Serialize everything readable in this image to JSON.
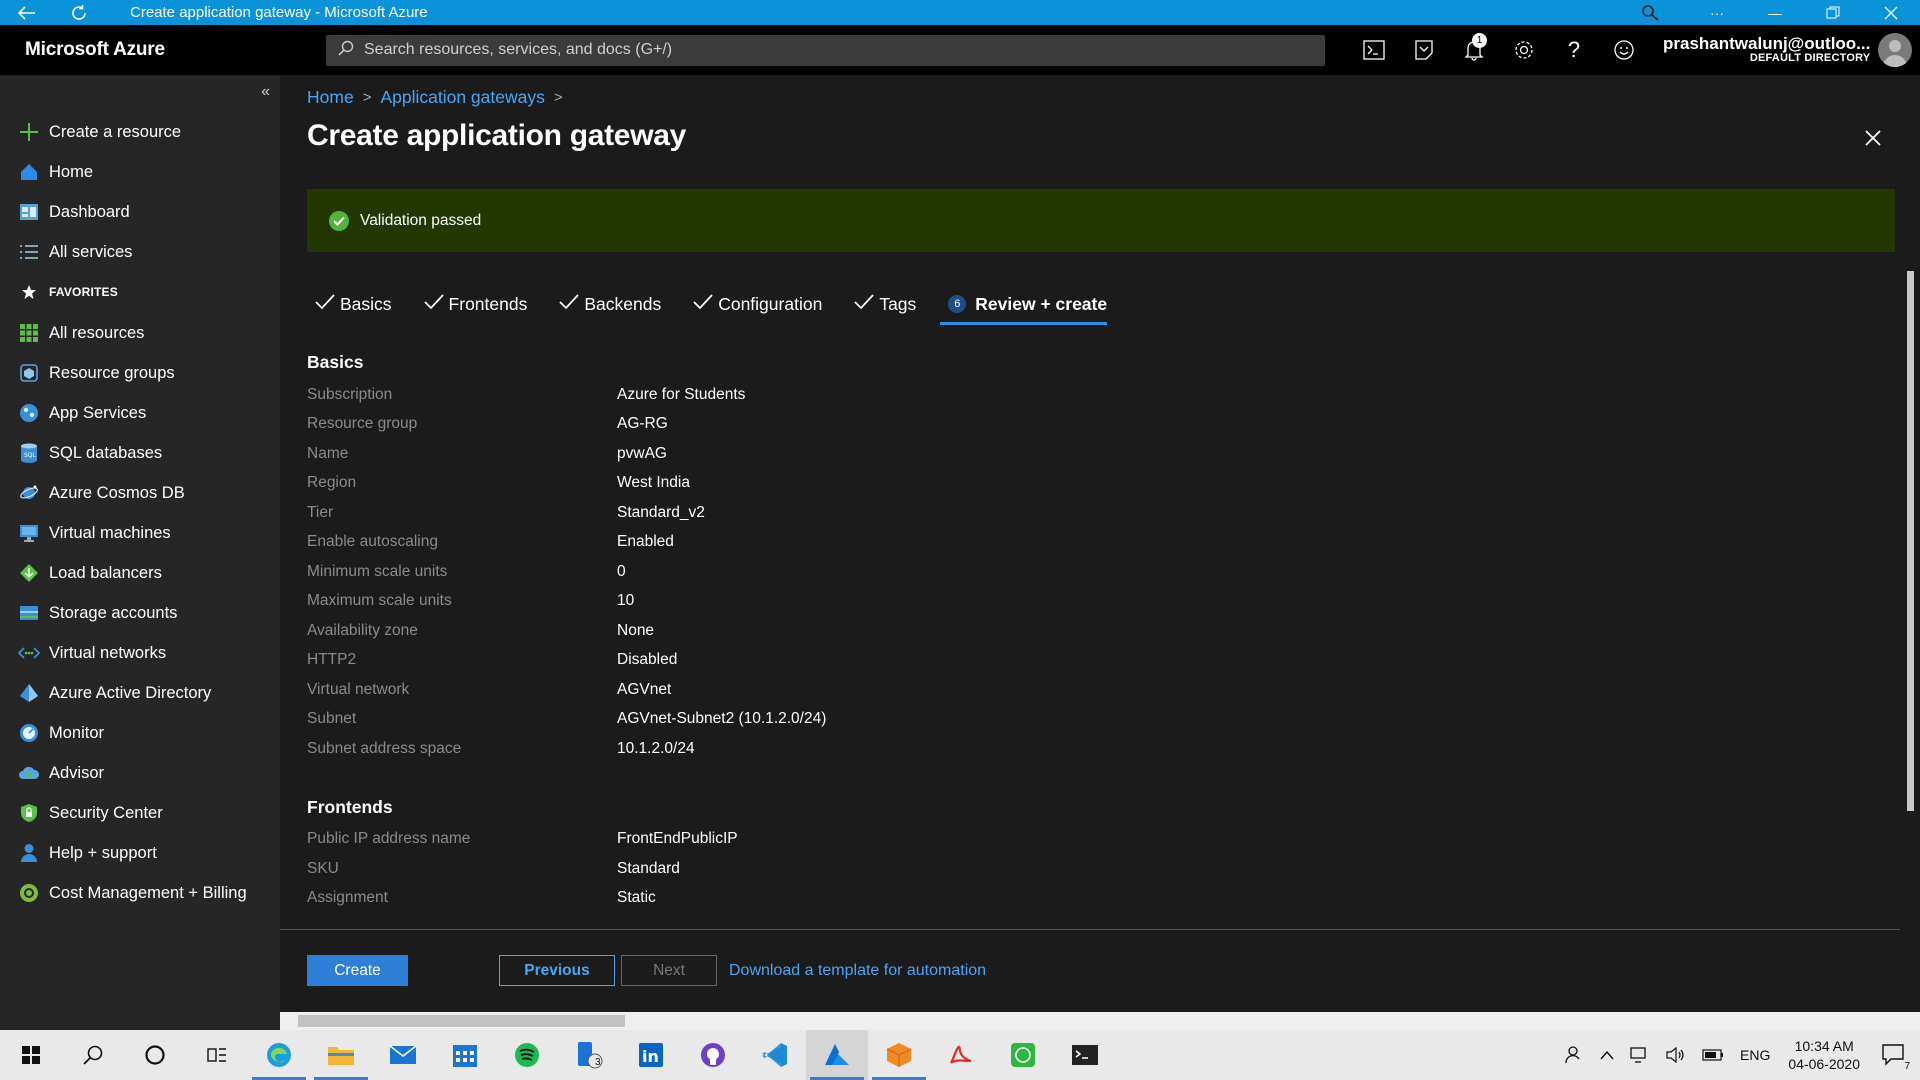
{
  "window": {
    "title": "Create application gateway - Microsoft Azure",
    "title_bar_icons": [
      "back-icon",
      "refresh-icon",
      "zoom-icon",
      "more-icon",
      "restore-icon",
      "close-icon"
    ]
  },
  "topbar": {
    "brand": "Microsoft Azure",
    "search_placeholder": "Search resources, services, and docs (G+/)",
    "notification_count": "1",
    "user_email": "prashantwalunj@outloo...",
    "user_directory": "DEFAULT DIRECTORY",
    "icons": [
      "cloud-shell-icon",
      "directory-filter-icon",
      "bell-icon",
      "gear-icon",
      "help-icon",
      "feedback-smiley-icon"
    ]
  },
  "sidebar": {
    "items": [
      {
        "label": "Create a resource",
        "icon": "plus-icon"
      },
      {
        "label": "Home",
        "icon": "home-icon"
      },
      {
        "label": "Dashboard",
        "icon": "dashboard-icon"
      },
      {
        "label": "All services",
        "icon": "list-icon"
      },
      {
        "label": "FAVORITES",
        "icon": "star-icon"
      },
      {
        "label": "All resources",
        "icon": "grid-icon"
      },
      {
        "label": "Resource groups",
        "icon": "cube-icon"
      },
      {
        "label": "App Services",
        "icon": "globe-icon"
      },
      {
        "label": "SQL databases",
        "icon": "sql-database-icon"
      },
      {
        "label": "Azure Cosmos DB",
        "icon": "cosmos-db-icon"
      },
      {
        "label": "Virtual machines",
        "icon": "monitor-icon"
      },
      {
        "label": "Load balancers",
        "icon": "diamond-icon"
      },
      {
        "label": "Storage accounts",
        "icon": "storage-icon"
      },
      {
        "label": "Virtual networks",
        "icon": "network-arrows-icon"
      },
      {
        "label": "Azure Active Directory",
        "icon": "pyramid-icon"
      },
      {
        "label": "Monitor",
        "icon": "gauge-icon"
      },
      {
        "label": "Advisor",
        "icon": "cloud-icon"
      },
      {
        "label": "Security Center",
        "icon": "shield-icon"
      },
      {
        "label": "Help + support",
        "icon": "person-icon"
      },
      {
        "label": "Cost Management + Billing",
        "icon": "coin-icon"
      }
    ]
  },
  "breadcrumb": [
    "Home",
    "Application gateways"
  ],
  "page_title": "Create application gateway",
  "banner": {
    "text": "Validation passed",
    "color": "#223800"
  },
  "tabs": [
    {
      "label": "Basics",
      "done": true
    },
    {
      "label": "Frontends",
      "done": true
    },
    {
      "label": "Backends",
      "done": true
    },
    {
      "label": "Configuration",
      "done": true
    },
    {
      "label": "Tags",
      "done": true
    },
    {
      "label": "Review + create",
      "step": "6",
      "active": true
    }
  ],
  "sections": [
    {
      "title": "Basics",
      "rows": [
        {
          "k": "Subscription",
          "v": "Azure for Students"
        },
        {
          "k": "Resource group",
          "v": "AG-RG"
        },
        {
          "k": "Name",
          "v": "pvwAG"
        },
        {
          "k": "Region",
          "v": "West India"
        },
        {
          "k": "Tier",
          "v": "Standard_v2"
        },
        {
          "k": "Enable autoscaling",
          "v": "Enabled"
        },
        {
          "k": "Minimum scale units",
          "v": "0"
        },
        {
          "k": "Maximum scale units",
          "v": "10"
        },
        {
          "k": "Availability zone",
          "v": "None"
        },
        {
          "k": "HTTP2",
          "v": "Disabled"
        },
        {
          "k": "Virtual network",
          "v": "AGVnet"
        },
        {
          "k": "Subnet",
          "v": "AGVnet-Subnet2 (10.1.2.0/24)"
        },
        {
          "k": "Subnet address space",
          "v": "10.1.2.0/24"
        }
      ]
    },
    {
      "title": "Frontends",
      "rows": [
        {
          "k": "Public IP address name",
          "v": "FrontEndPublicIP"
        },
        {
          "k": "SKU",
          "v": "Standard"
        },
        {
          "k": "Assignment",
          "v": "Static"
        }
      ]
    }
  ],
  "footer": {
    "create": "Create",
    "previous": "Previous",
    "next": "Next",
    "download": "Download a template for automation"
  },
  "taskbar": {
    "apps": [
      "windows-start-icon",
      "search-icon",
      "cortana-icon",
      "task-view-icon",
      "edge-icon",
      "file-explorer-icon",
      "mail-icon",
      "calendar-icon",
      "spotify-icon",
      "phone-app-icon",
      "linkedin-icon",
      "github-icon",
      "vscode-icon",
      "azure-icon",
      "box-app-icon",
      "acrobat-icon",
      "whatsapp-icon",
      "terminal-icon"
    ],
    "phone_badge": "3",
    "language": "ENG",
    "time": "10:34 AM",
    "date": "04-06-2020",
    "notification_count": "7",
    "accent": "#3a7bd5"
  }
}
